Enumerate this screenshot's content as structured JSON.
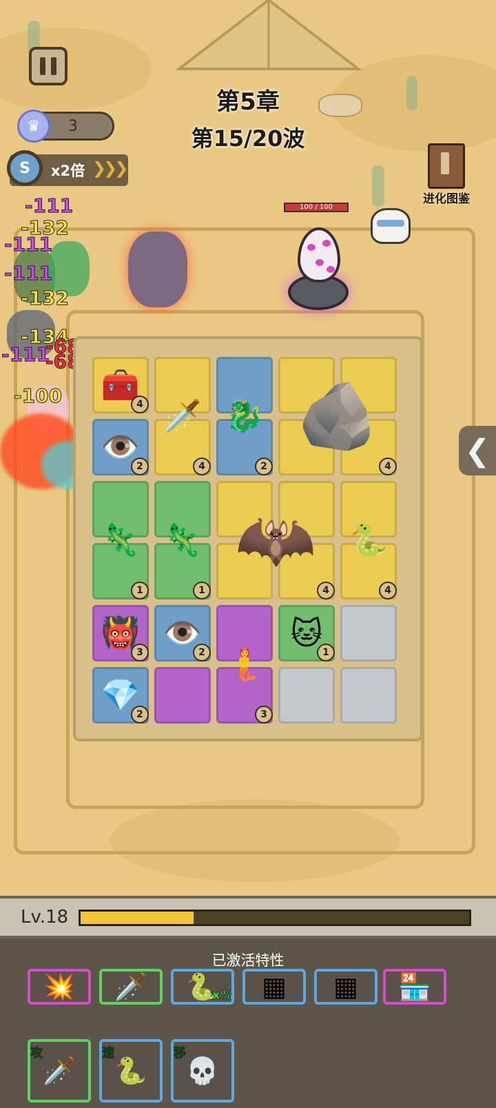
{
  "hud": {
    "crown_count": "3",
    "speed_label": "x2倍",
    "speed_clock_letter": "S",
    "chapter": "第5章",
    "wave": "第15/20波",
    "guide_label": "进化图鉴",
    "boss_hp": "100 / 100"
  },
  "damage_numbers": [
    {
      "text": "-111",
      "color": "#c64be0"
    },
    {
      "text": "-132",
      "color": "#f0e43c"
    },
    {
      "text": "-111",
      "color": "#c64be0"
    },
    {
      "text": "-111",
      "color": "#c64be0"
    },
    {
      "text": "-132",
      "color": "#f0e43c"
    },
    {
      "text": "-134",
      "color": "#f0e43c"
    },
    {
      "text": "-68",
      "color": "#e83232"
    },
    {
      "text": "-111",
      "color": "#c64be0"
    },
    {
      "text": "-68",
      "color": "#e83232"
    },
    {
      "text": "-100",
      "color": "#f0e43c"
    }
  ],
  "board": {
    "units": [
      {
        "name": "treasure-chest-unit",
        "glyph": "🧰",
        "level": "4",
        "tile": "yellow"
      },
      {
        "name": "skeleton-king-unit",
        "glyph": "🗡️",
        "level": "4",
        "tile": "yellow"
      },
      {
        "name": "dragon-trident-unit",
        "glyph": "🐉",
        "level": "2",
        "tile": "blue"
      },
      {
        "name": "lava-golem-unit",
        "glyph": "🪨",
        "level": "4",
        "tile": "yellow"
      },
      {
        "name": "cyclops-slime-unit",
        "glyph": "👁️",
        "level": "2",
        "tile": "blue"
      },
      {
        "name": "lizard-archer-unit",
        "glyph": "🦎",
        "level": "1",
        "tile": "green"
      },
      {
        "name": "lizard-archer-unit-2",
        "glyph": "🦎",
        "level": "1",
        "tile": "green"
      },
      {
        "name": "bat-monster-unit",
        "glyph": "🦇",
        "level": "4",
        "tile": "yellow"
      },
      {
        "name": "king-serpent-unit",
        "glyph": "🐍",
        "level": "4",
        "tile": "yellow"
      },
      {
        "name": "horned-demon-unit",
        "glyph": "👹",
        "level": "3",
        "tile": "purple"
      },
      {
        "name": "cyclops-slime-unit-2",
        "glyph": "👁️",
        "level": "2",
        "tile": "blue"
      },
      {
        "name": "mermaid-queen-unit",
        "glyph": "🧜",
        "level": "3",
        "tile": "purple"
      },
      {
        "name": "cat-slime-unit",
        "glyph": "🐱",
        "level": "1",
        "tile": "green"
      },
      {
        "name": "ice-crystal-unit",
        "glyph": "💎",
        "level": "2",
        "tile": "blue"
      }
    ]
  },
  "player": {
    "level_label": "Lv.18",
    "xp_progress": 0.29
  },
  "traits": {
    "title": "已激活特性",
    "items": [
      {
        "glyph": "💥",
        "color": "purple",
        "badge": ""
      },
      {
        "glyph": "🗡️",
        "color": "green",
        "badge": ""
      },
      {
        "glyph": "🐍",
        "color": "blue",
        "badge": "x%"
      },
      {
        "glyph": "▦",
        "color": "blue",
        "badge": ""
      },
      {
        "glyph": "▦",
        "color": "blue",
        "badge": ""
      },
      {
        "glyph": "🏪",
        "color": "purple",
        "badge": ""
      },
      {
        "glyph": "🗡️",
        "color": "green",
        "badge": "攻"
      },
      {
        "glyph": "🐍",
        "color": "blue",
        "badge": "速"
      },
      {
        "glyph": "💀",
        "color": "blue",
        "badge": "移"
      }
    ]
  }
}
